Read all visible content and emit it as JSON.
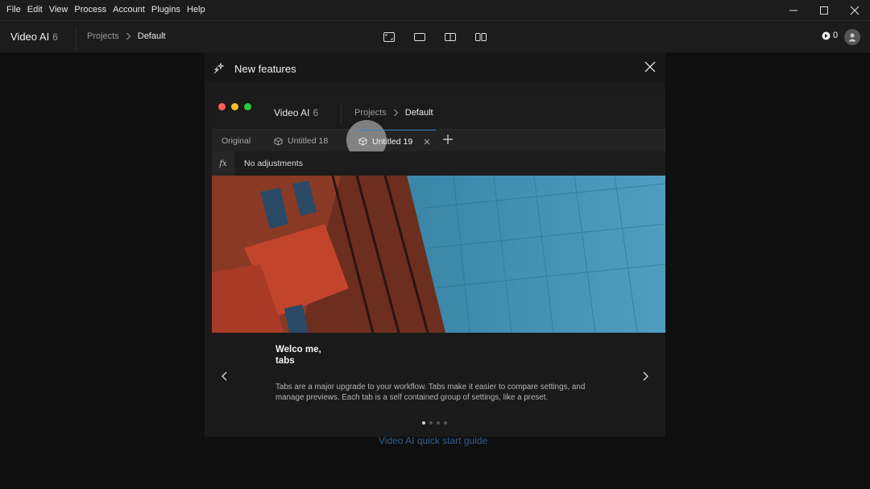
{
  "menu": [
    "File",
    "Edit",
    "View",
    "Process",
    "Account",
    "Plugins",
    "Help"
  ],
  "app": {
    "title": "Video AI",
    "version": "6",
    "breadcrumb": {
      "parent": "Projects",
      "current": "Default"
    },
    "credits": "0"
  },
  "background_link": "Video AI quick start guide",
  "modal": {
    "title": "New features",
    "preview": {
      "app_title": "Video AI",
      "app_version": "6",
      "breadcrumb_parent": "Projects",
      "breadcrumb_current": "Default",
      "tabs": [
        {
          "label": "Original"
        },
        {
          "label": "Untitled 18"
        },
        {
          "label": "Untitled 19",
          "active": true
        }
      ],
      "fx_label": "fx",
      "adjustments_text": "No adjustments"
    },
    "feature": {
      "title": "Welco me, tabs",
      "description": "Tabs are a major upgrade to your workflow. Tabs make it easier to compare settings, and manage previews. Each tab is a self contained group of settings, like a preset."
    },
    "pagination": {
      "total": 4,
      "current": 1
    }
  },
  "colors": {
    "accent": "#2f7fd1",
    "link": "#2f5f8f",
    "traffic_red": "#ff5f57",
    "traffic_yellow": "#febc2e",
    "traffic_green": "#28c840"
  }
}
